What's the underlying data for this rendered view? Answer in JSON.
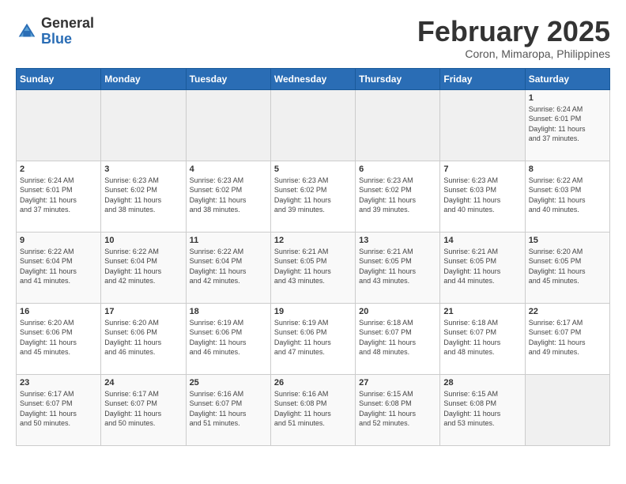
{
  "header": {
    "logo_general": "General",
    "logo_blue": "Blue",
    "month_year": "February 2025",
    "location": "Coron, Mimaropa, Philippines"
  },
  "days_of_week": [
    "Sunday",
    "Monday",
    "Tuesday",
    "Wednesday",
    "Thursday",
    "Friday",
    "Saturday"
  ],
  "weeks": [
    [
      {
        "day": "",
        "info": ""
      },
      {
        "day": "",
        "info": ""
      },
      {
        "day": "",
        "info": ""
      },
      {
        "day": "",
        "info": ""
      },
      {
        "day": "",
        "info": ""
      },
      {
        "day": "",
        "info": ""
      },
      {
        "day": "1",
        "info": "Sunrise: 6:24 AM\nSunset: 6:01 PM\nDaylight: 11 hours\nand 37 minutes."
      }
    ],
    [
      {
        "day": "2",
        "info": "Sunrise: 6:24 AM\nSunset: 6:01 PM\nDaylight: 11 hours\nand 37 minutes."
      },
      {
        "day": "3",
        "info": "Sunrise: 6:23 AM\nSunset: 6:02 PM\nDaylight: 11 hours\nand 38 minutes."
      },
      {
        "day": "4",
        "info": "Sunrise: 6:23 AM\nSunset: 6:02 PM\nDaylight: 11 hours\nand 38 minutes."
      },
      {
        "day": "5",
        "info": "Sunrise: 6:23 AM\nSunset: 6:02 PM\nDaylight: 11 hours\nand 39 minutes."
      },
      {
        "day": "6",
        "info": "Sunrise: 6:23 AM\nSunset: 6:02 PM\nDaylight: 11 hours\nand 39 minutes."
      },
      {
        "day": "7",
        "info": "Sunrise: 6:23 AM\nSunset: 6:03 PM\nDaylight: 11 hours\nand 40 minutes."
      },
      {
        "day": "8",
        "info": "Sunrise: 6:22 AM\nSunset: 6:03 PM\nDaylight: 11 hours\nand 40 minutes."
      }
    ],
    [
      {
        "day": "9",
        "info": "Sunrise: 6:22 AM\nSunset: 6:04 PM\nDaylight: 11 hours\nand 41 minutes."
      },
      {
        "day": "10",
        "info": "Sunrise: 6:22 AM\nSunset: 6:04 PM\nDaylight: 11 hours\nand 42 minutes."
      },
      {
        "day": "11",
        "info": "Sunrise: 6:22 AM\nSunset: 6:04 PM\nDaylight: 11 hours\nand 42 minutes."
      },
      {
        "day": "12",
        "info": "Sunrise: 6:21 AM\nSunset: 6:05 PM\nDaylight: 11 hours\nand 43 minutes."
      },
      {
        "day": "13",
        "info": "Sunrise: 6:21 AM\nSunset: 6:05 PM\nDaylight: 11 hours\nand 43 minutes."
      },
      {
        "day": "14",
        "info": "Sunrise: 6:21 AM\nSunset: 6:05 PM\nDaylight: 11 hours\nand 44 minutes."
      },
      {
        "day": "15",
        "info": "Sunrise: 6:20 AM\nSunset: 6:05 PM\nDaylight: 11 hours\nand 45 minutes."
      }
    ],
    [
      {
        "day": "16",
        "info": "Sunrise: 6:20 AM\nSunset: 6:06 PM\nDaylight: 11 hours\nand 45 minutes."
      },
      {
        "day": "17",
        "info": "Sunrise: 6:20 AM\nSunset: 6:06 PM\nDaylight: 11 hours\nand 46 minutes."
      },
      {
        "day": "18",
        "info": "Sunrise: 6:19 AM\nSunset: 6:06 PM\nDaylight: 11 hours\nand 46 minutes."
      },
      {
        "day": "19",
        "info": "Sunrise: 6:19 AM\nSunset: 6:06 PM\nDaylight: 11 hours\nand 47 minutes."
      },
      {
        "day": "20",
        "info": "Sunrise: 6:18 AM\nSunset: 6:07 PM\nDaylight: 11 hours\nand 48 minutes."
      },
      {
        "day": "21",
        "info": "Sunrise: 6:18 AM\nSunset: 6:07 PM\nDaylight: 11 hours\nand 48 minutes."
      },
      {
        "day": "22",
        "info": "Sunrise: 6:17 AM\nSunset: 6:07 PM\nDaylight: 11 hours\nand 49 minutes."
      }
    ],
    [
      {
        "day": "23",
        "info": "Sunrise: 6:17 AM\nSunset: 6:07 PM\nDaylight: 11 hours\nand 50 minutes."
      },
      {
        "day": "24",
        "info": "Sunrise: 6:17 AM\nSunset: 6:07 PM\nDaylight: 11 hours\nand 50 minutes."
      },
      {
        "day": "25",
        "info": "Sunrise: 6:16 AM\nSunset: 6:07 PM\nDaylight: 11 hours\nand 51 minutes."
      },
      {
        "day": "26",
        "info": "Sunrise: 6:16 AM\nSunset: 6:08 PM\nDaylight: 11 hours\nand 51 minutes."
      },
      {
        "day": "27",
        "info": "Sunrise: 6:15 AM\nSunset: 6:08 PM\nDaylight: 11 hours\nand 52 minutes."
      },
      {
        "day": "28",
        "info": "Sunrise: 6:15 AM\nSunset: 6:08 PM\nDaylight: 11 hours\nand 53 minutes."
      },
      {
        "day": "",
        "info": ""
      }
    ]
  ]
}
